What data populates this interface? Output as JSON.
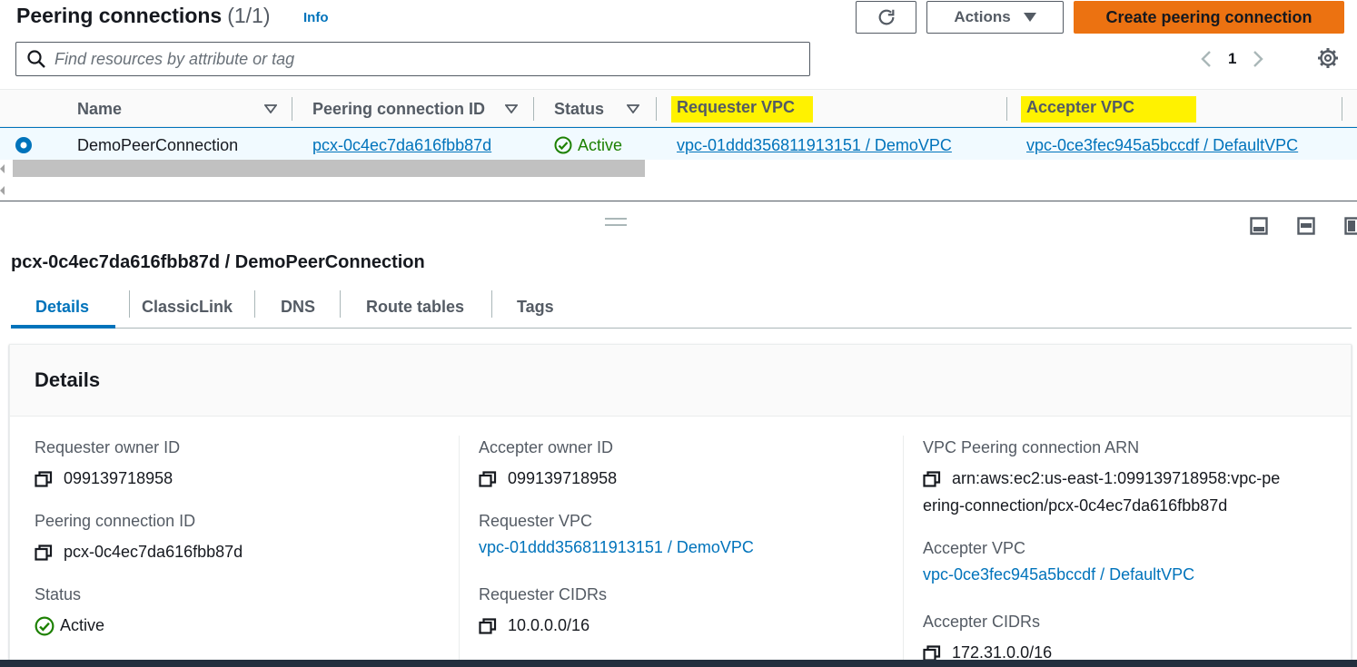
{
  "header": {
    "title": "Peering connections",
    "count": "(1/1)",
    "info": "Info",
    "actions_label": "Actions",
    "create_label": "Create peering connection",
    "search_placeholder": "Find resources by attribute or tag",
    "page_number": "1"
  },
  "table": {
    "columns": [
      "Name",
      "Peering connection ID",
      "Status",
      "Requester VPC",
      "Accepter VPC"
    ],
    "rows": [
      {
        "name": "DemoPeerConnection",
        "id": "pcx-0c4ec7da616fbb87d",
        "status": "Active",
        "requester_vpc": "vpc-01ddd356811913151 / DemoVPC",
        "accepter_vpc": "vpc-0ce3fec945a5bccdf / DefaultVPC"
      }
    ]
  },
  "detail": {
    "title": "pcx-0c4ec7da616fbb87d / DemoPeerConnection",
    "tabs": [
      "Details",
      "ClassicLink",
      "DNS",
      "Route tables",
      "Tags"
    ],
    "section_title": "Details",
    "fields": {
      "requester_owner_label": "Requester owner ID",
      "requester_owner_value": "099139718958",
      "peering_id_label": "Peering connection ID",
      "peering_id_value": "pcx-0c4ec7da616fbb87d",
      "status_label": "Status",
      "status_value": "Active",
      "accepter_owner_label": "Accepter owner ID",
      "accepter_owner_value": "099139718958",
      "requester_vpc_label": "Requester VPC",
      "requester_vpc_value": "vpc-01ddd356811913151 / DemoVPC",
      "requester_cidrs_label": "Requester CIDRs",
      "requester_cidrs_value": "10.0.0.0/16",
      "arn_label": "VPC Peering connection ARN",
      "arn_value": "arn:aws:ec2:us-east-1:099139718958:vpc-peering-connection/pcx-0c4ec7da616fbb87d",
      "accepter_vpc_label": "Accepter VPC",
      "accepter_vpc_value": "vpc-0ce3fec945a5bccdf / DefaultVPC",
      "accepter_cidrs_label": "Accepter CIDRs",
      "accepter_cidrs_value": "172.31.0.0/16"
    }
  },
  "colors": {
    "primary_button": "#ec7211",
    "link": "#0073bb",
    "status_active": "#1d8102",
    "highlight": "#fff200"
  }
}
